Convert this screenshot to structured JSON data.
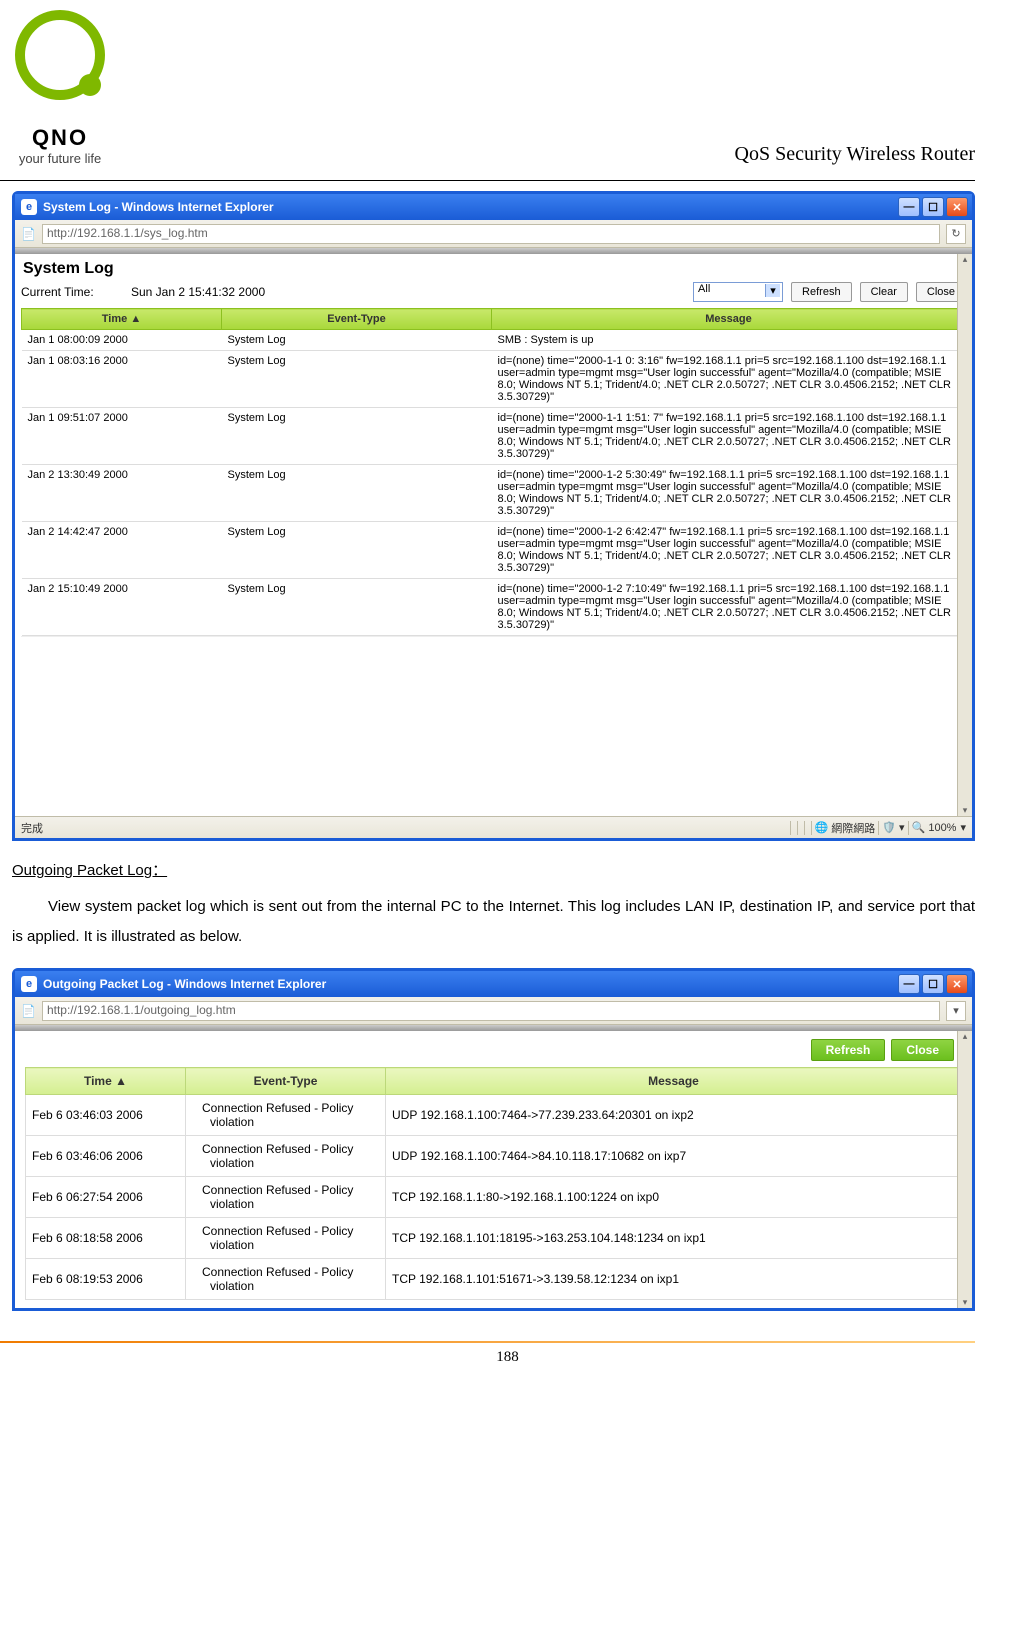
{
  "doc": {
    "product_title": "QoS Security Wireless Router",
    "logo_name": "QNO",
    "logo_tag": "your future life",
    "page_number": "188"
  },
  "window1": {
    "title": "System Log - Windows Internet Explorer",
    "url": "http://192.168.1.1/sys_log.htm",
    "page_heading": "System Log",
    "current_time_label": "Current Time:",
    "current_time_value": "Sun Jan 2 15:41:32 2000",
    "filter_select": "All",
    "btn_refresh": "Refresh",
    "btn_clear": "Clear",
    "btn_close": "Close",
    "columns": {
      "time": "Time    ▲",
      "etype": "Event-Type",
      "msg": "Message"
    },
    "rows": [
      {
        "time": "Jan 1 08:00:09 2000",
        "etype": "System Log",
        "msg": "SMB : System is up"
      },
      {
        "time": "Jan 1 08:03:16 2000",
        "etype": "System Log",
        "msg": "id=(none) time=\"2000-1-1 0: 3:16\" fw=192.168.1.1 pri=5 src=192.168.1.100 dst=192.168.1.1 user=admin type=mgmt msg=\"User login successful\" agent=\"Mozilla/4.0 (compatible; MSIE 8.0; Windows NT 5.1; Trident/4.0; .NET CLR 2.0.50727; .NET CLR 3.0.4506.2152; .NET CLR 3.5.30729)\""
      },
      {
        "time": "Jan 1 09:51:07 2000",
        "etype": "System Log",
        "msg": "id=(none) time=\"2000-1-1 1:51: 7\" fw=192.168.1.1 pri=5 src=192.168.1.100 dst=192.168.1.1 user=admin type=mgmt msg=\"User login successful\" agent=\"Mozilla/4.0 (compatible; MSIE 8.0; Windows NT 5.1; Trident/4.0; .NET CLR 2.0.50727; .NET CLR 3.0.4506.2152; .NET CLR 3.5.30729)\""
      },
      {
        "time": "Jan 2 13:30:49 2000",
        "etype": "System Log",
        "msg": "id=(none) time=\"2000-1-2 5:30:49\" fw=192.168.1.1 pri=5 src=192.168.1.100 dst=192.168.1.1 user=admin type=mgmt msg=\"User login successful\" agent=\"Mozilla/4.0 (compatible; MSIE 8.0; Windows NT 5.1; Trident/4.0; .NET CLR 2.0.50727; .NET CLR 3.0.4506.2152; .NET CLR 3.5.30729)\""
      },
      {
        "time": "Jan 2 14:42:47 2000",
        "etype": "System Log",
        "msg": "id=(none) time=\"2000-1-2 6:42:47\" fw=192.168.1.1 pri=5 src=192.168.1.100 dst=192.168.1.1 user=admin type=mgmt msg=\"User login successful\" agent=\"Mozilla/4.0 (compatible; MSIE 8.0; Windows NT 5.1; Trident/4.0; .NET CLR 2.0.50727; .NET CLR 3.0.4506.2152; .NET CLR 3.5.30729)\""
      },
      {
        "time": "Jan 2 15:10:49 2000",
        "etype": "System Log",
        "msg": "id=(none) time=\"2000-1-2 7:10:49\" fw=192.168.1.1 pri=5 src=192.168.1.100 dst=192.168.1.1 user=admin type=mgmt msg=\"User login successful\" agent=\"Mozilla/4.0 (compatible; MSIE 8.0; Windows NT 5.1; Trident/4.0; .NET CLR 2.0.50727; .NET CLR 3.0.4506.2152; .NET CLR 3.5.30729)\""
      }
    ],
    "status_done": "完成",
    "status_zone": "網際網路",
    "zoom": "100%"
  },
  "text1": {
    "heading": "Outgoing Packet Log：",
    "body": "View system packet log which is sent out from the internal PC to the Internet. This log includes LAN IP, destination IP, and service port that is applied. It is illustrated as below."
  },
  "window2": {
    "title": "Outgoing Packet Log - Windows Internet Explorer",
    "url": "http://192.168.1.1/outgoing_log.htm",
    "btn_refresh": "Refresh",
    "btn_close": "Close",
    "columns": {
      "time": "Time ▲",
      "etype": "Event-Type",
      "msg": "Message"
    },
    "rows": [
      {
        "time": "Feb 6 03:46:03 2006",
        "etype": "Connection Refused - Policy violation",
        "msg": "UDP 192.168.1.100:7464->77.239.233.64:20301 on ixp2"
      },
      {
        "time": "Feb 6 03:46:06 2006",
        "etype": "Connection Refused - Policy violation",
        "msg": "UDP 192.168.1.100:7464->84.10.118.17:10682 on ixp7"
      },
      {
        "time": "Feb 6 06:27:54 2006",
        "etype": "Connection Refused - Policy violation",
        "msg": "TCP 192.168.1.1:80->192.168.1.100:1224 on ixp0"
      },
      {
        "time": "Feb 6 08:18:58 2006",
        "etype": "Connection Refused - Policy violation",
        "msg": "TCP 192.168.1.101:18195->163.253.104.148:1234 on ixp1"
      },
      {
        "time": "Feb 6 08:19:53 2006",
        "etype": "Connection Refused - Policy violation",
        "msg": "TCP 192.168.1.101:51671->3.139.58.12:1234 on ixp1"
      }
    ]
  }
}
